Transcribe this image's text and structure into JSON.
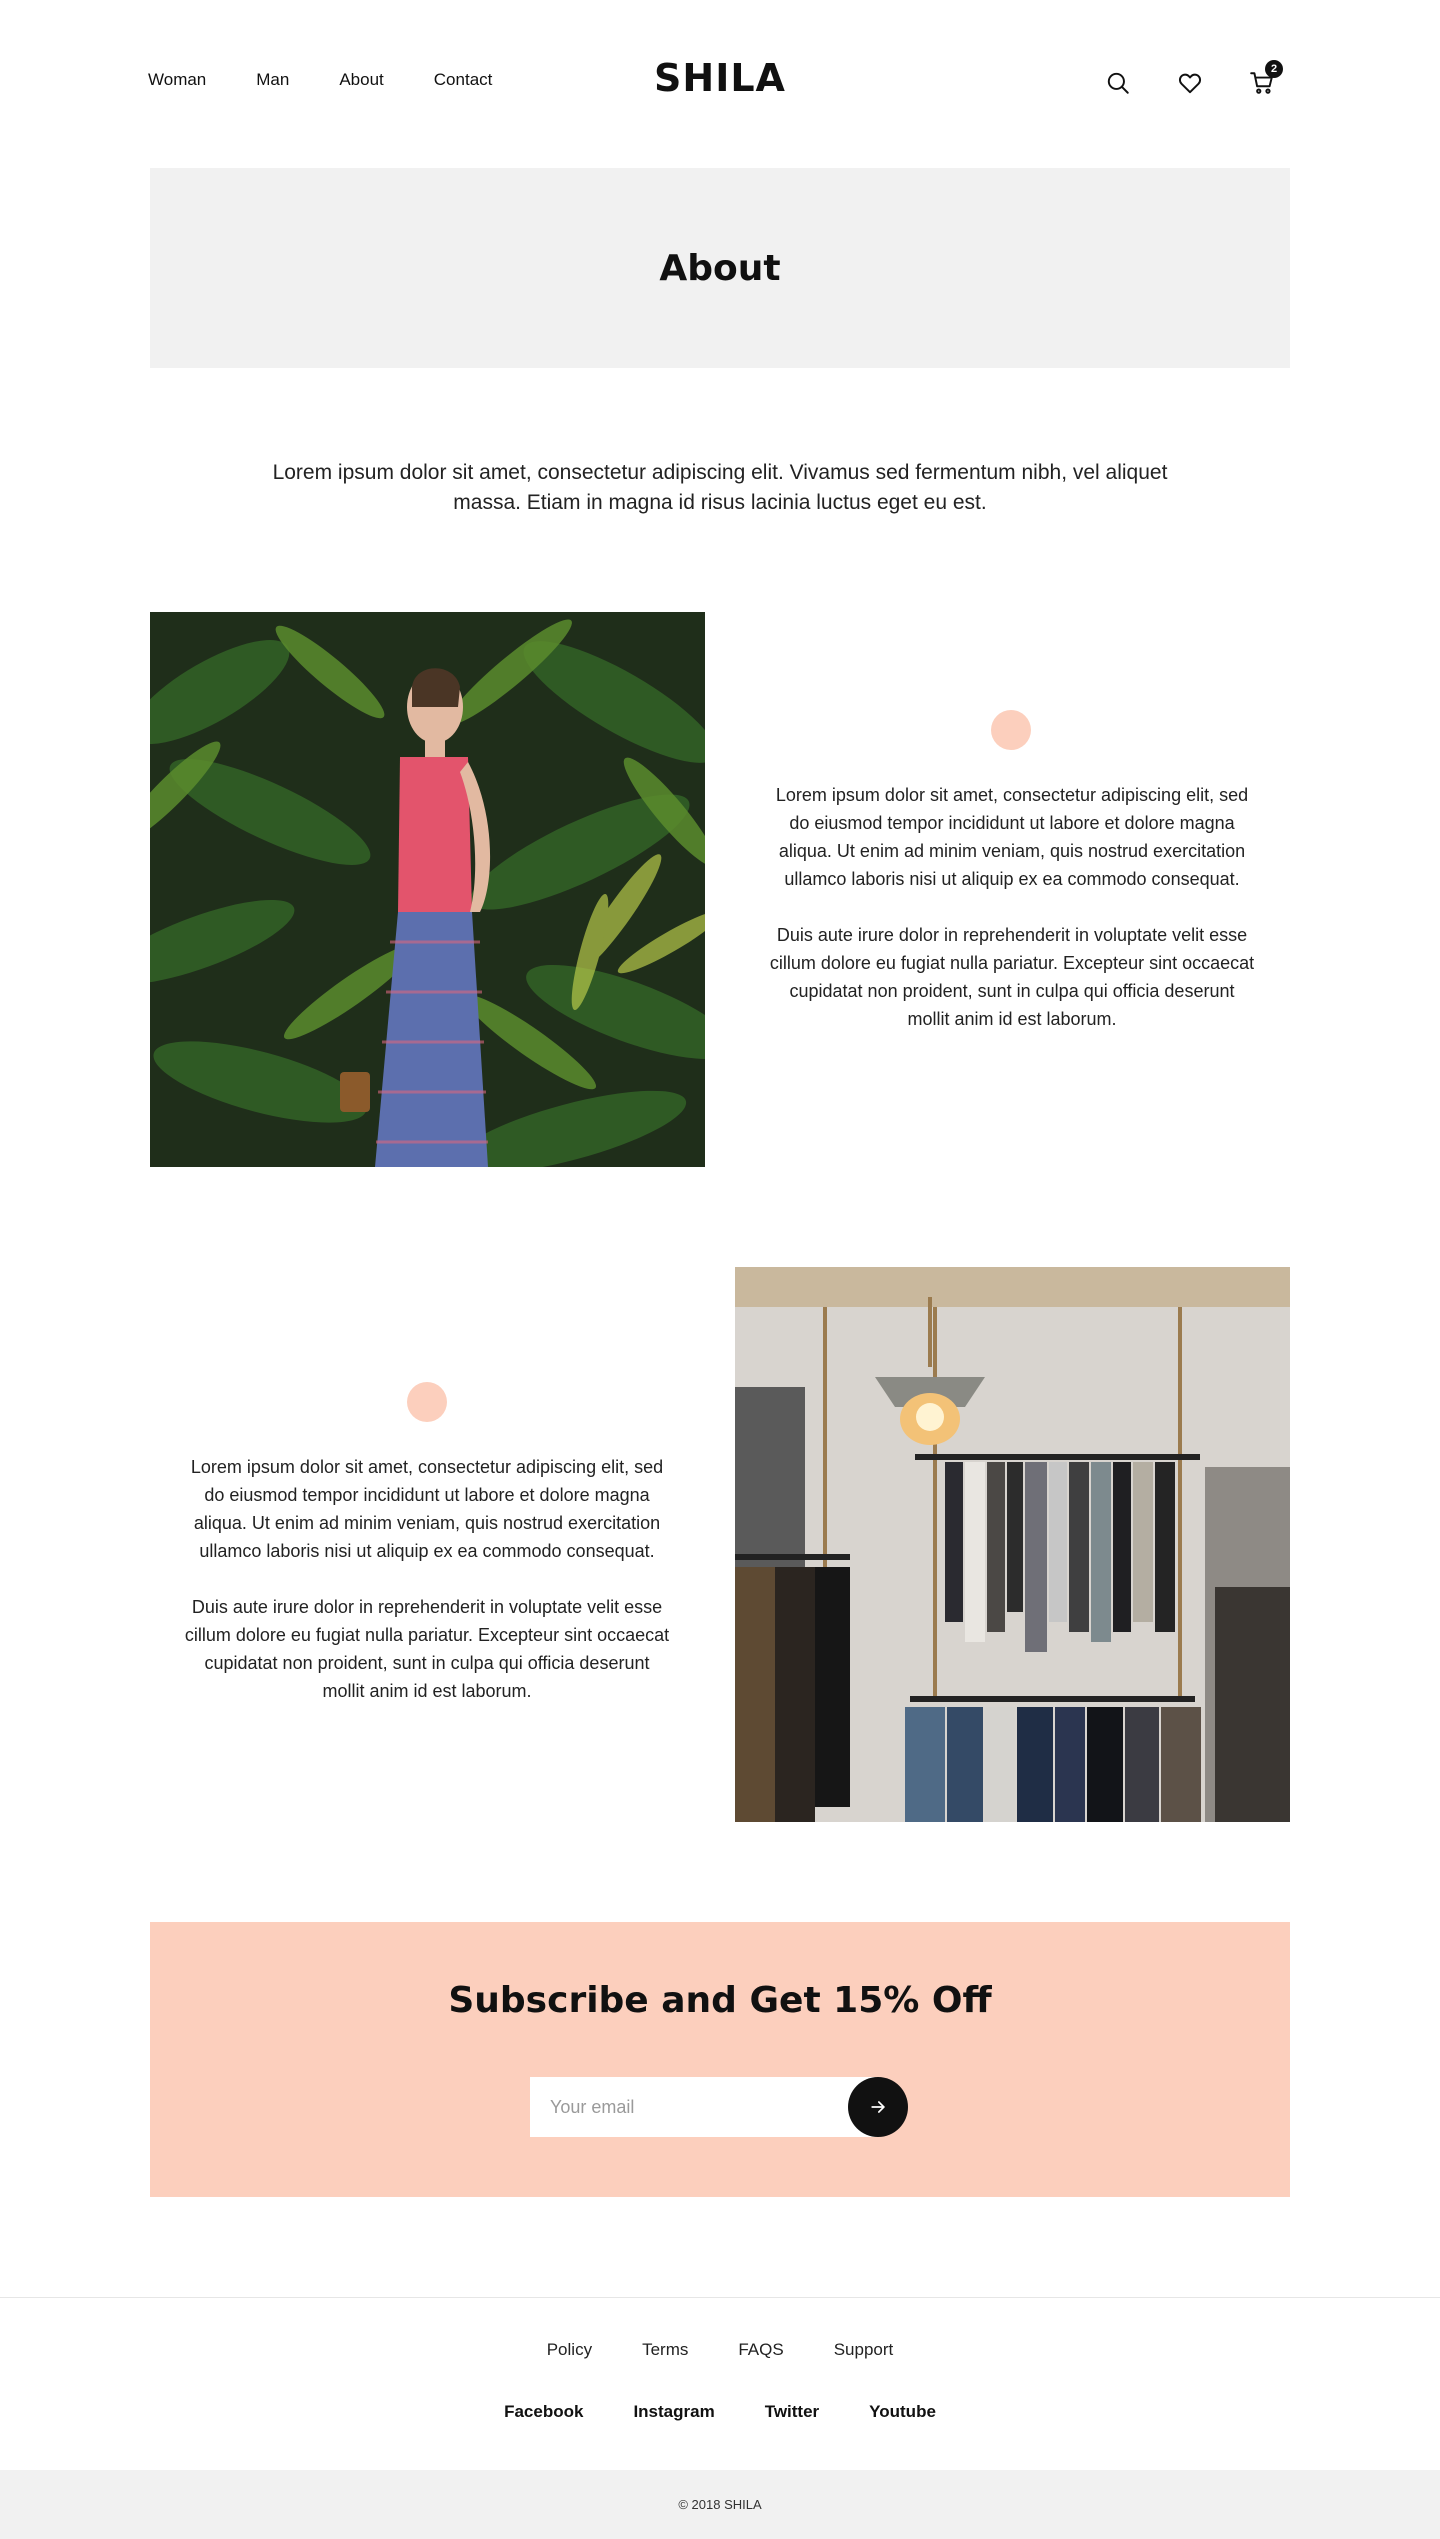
{
  "header": {
    "nav": [
      "Woman",
      "Man",
      "About",
      "Contact"
    ],
    "logo": "SHILA",
    "icons": [
      "search-icon",
      "heart-icon",
      "cart-icon"
    ],
    "cart_count": "2"
  },
  "banner": {
    "title": "About"
  },
  "intro": {
    "text": "Lorem ipsum dolor sit amet, consectetur adipiscing elit. Vivamus sed fermentum nibh, vel aliquet massa. Etiam in magna id risus lacinia luctus eget eu est."
  },
  "features": [
    {
      "paragraphs": [
        "Lorem ipsum dolor sit amet, consectetur adipiscing elit, sed do eiusmod tempor incididunt ut labore et dolore magna aliqua. Ut enim ad minim veniam, quis nostrud exercitation ullamco laboris nisi ut aliquip ex ea commodo consequat.",
        "Duis aute irure dolor in reprehenderit in voluptate velit esse cillum dolore eu fugiat nulla pariatur. Excepteur sint occaecat cupidatat non proident, sunt in culpa qui officia deserunt mollit anim id est laborum."
      ]
    },
    {
      "paragraphs": [
        "Lorem ipsum dolor sit amet, consectetur adipiscing elit, sed do eiusmod tempor incididunt ut labore et dolore magna aliqua. Ut enim ad minim veniam, quis nostrud exercitation ullamco laboris nisi ut aliquip ex ea commodo consequat.",
        "Duis aute irure dolor in reprehenderit in voluptate velit esse cillum dolore eu fugiat nulla pariatur. Excepteur sint occaecat cupidatat non proident, sunt in culpa qui officia deserunt mollit anim id est laborum."
      ]
    }
  ],
  "subscribe": {
    "title": "Subscribe and Get 15% Off",
    "placeholder": "Your email",
    "button_icon": "arrow-right-icon"
  },
  "footer": {
    "links": [
      "Policy",
      "Terms",
      "FAQS",
      "Support"
    ],
    "social": [
      "Facebook",
      "Instagram",
      "Twitter",
      "Youtube"
    ],
    "copyright": "© 2018 SHILA"
  },
  "colors": {
    "accent": "#fccfbd",
    "dark": "#111111",
    "banner_bg": "#f1f1f1"
  }
}
